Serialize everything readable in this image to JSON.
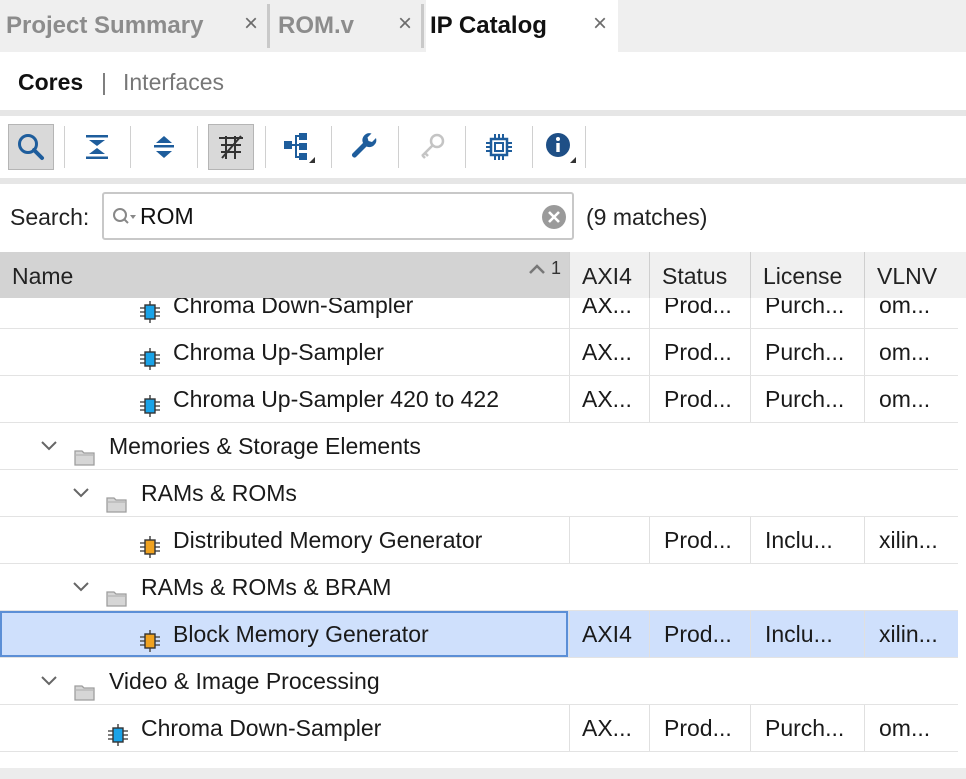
{
  "tabs": [
    {
      "label": "Project Summary",
      "active": false
    },
    {
      "label": "ROM.v",
      "active": false
    },
    {
      "label": "IP Catalog",
      "active": true
    }
  ],
  "tab_close_glyph": "×",
  "subtabs": {
    "active": "Cores",
    "separator": "|",
    "inactive": "Interfaces"
  },
  "toolbar": [
    {
      "name": "search-icon",
      "pressed": true
    },
    {
      "name": "collapse-all-icon"
    },
    {
      "name": "expand-all-icon"
    },
    {
      "name": "filter-icon",
      "pressed": true
    },
    {
      "name": "hierarchy-icon"
    },
    {
      "name": "wrench-icon"
    },
    {
      "name": "key-icon",
      "disabled": true
    },
    {
      "name": "chip-icon"
    },
    {
      "name": "info-icon"
    }
  ],
  "search": {
    "label": "Search:",
    "value": "ROM",
    "matches": "(9 matches)"
  },
  "table": {
    "columns": {
      "name": "Name",
      "sort_indicator": "1",
      "axi4": "AXI4",
      "status": "Status",
      "license": "License",
      "vlnv": "VLNV"
    },
    "rows": [
      {
        "type": "ip",
        "icon": "blue",
        "label": "Chroma Down-Sampler",
        "axi4": "AX...",
        "status": "Prod...",
        "license": "Purch...",
        "vlnv": "om...",
        "partial": true
      },
      {
        "type": "ip",
        "icon": "blue",
        "label": "Chroma Up-Sampler",
        "axi4": "AX...",
        "status": "Prod...",
        "license": "Purch...",
        "vlnv": "om..."
      },
      {
        "type": "ip",
        "icon": "blue",
        "label": "Chroma Up-Sampler 420 to 422",
        "axi4": "AX...",
        "status": "Prod...",
        "license": "Purch...",
        "vlnv": "om..."
      },
      {
        "type": "folder",
        "level": 0,
        "label": "Memories & Storage Elements"
      },
      {
        "type": "folder",
        "level": 1,
        "label": "RAMs & ROMs"
      },
      {
        "type": "ip",
        "icon": "orange",
        "label": "Distributed Memory Generator",
        "axi4": "",
        "status": "Prod...",
        "license": "Inclu...",
        "vlnv": "xilin..."
      },
      {
        "type": "folder",
        "level": 1,
        "label": "RAMs & ROMs & BRAM"
      },
      {
        "type": "ip",
        "icon": "orange",
        "label": "Block Memory Generator",
        "axi4": "AXI4",
        "status": "Prod...",
        "license": "Inclu...",
        "vlnv": "xilin...",
        "selected": true
      },
      {
        "type": "folder",
        "level": 0,
        "label": "Video & Image Processing"
      },
      {
        "type": "ip",
        "icon": "blue",
        "indent": "shallow",
        "label": "Chroma Down-Sampler",
        "axi4": "AX...",
        "status": "Prod...",
        "license": "Purch...",
        "vlnv": "om..."
      }
    ]
  },
  "colors": {
    "selected_row": "#cfe0fc",
    "ip_blue": "#1aa3e8",
    "ip_orange": "#f0a21f",
    "folder": "#b5b5b5"
  }
}
